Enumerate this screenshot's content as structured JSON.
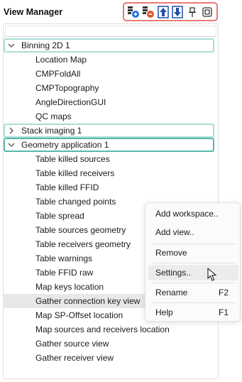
{
  "header": {
    "title": "View Manager"
  },
  "toolbar": {
    "buttons": [
      {
        "icon": "add-view-icon"
      },
      {
        "icon": "remove-view-icon"
      },
      {
        "icon": "move-up-icon"
      },
      {
        "icon": "move-down-icon"
      },
      {
        "icon": "pin-icon"
      },
      {
        "icon": "float-window-icon"
      }
    ],
    "accent": "#e87a7a"
  },
  "tree": {
    "groups": [
      {
        "label": "Binning 2D 1",
        "expanded": true,
        "children": [
          "Location Map",
          "CMPFoldAll",
          "CMPTopography",
          "AngleDirectionGUI",
          "QC maps"
        ]
      },
      {
        "label": "Stack imaging 1",
        "expanded": false,
        "children": []
      },
      {
        "label": "Geometry application 1",
        "expanded": true,
        "children": [
          "Table killed sources",
          "Table killed receivers",
          "Table killed FFID",
          "Table changed points",
          "Table spread",
          "Table sources geometry",
          "Table receivers geometry",
          "Table warnings",
          "Table FFID raw",
          "Map keys location",
          "Gather connection key view",
          "Map SP-Offset location",
          "Map sources and receivers location",
          "Gather source view",
          "Gather receiver view"
        ]
      }
    ],
    "group_border_color": "#a9ddd6",
    "active_group_border_color": "#57b8ab"
  },
  "context_menu": {
    "items": [
      {
        "label": "Add workspace..",
        "shortcut": ""
      },
      {
        "label": "Add view..",
        "shortcut": ""
      },
      {
        "label": "Remove",
        "shortcut": ""
      },
      {
        "label": "Settings..",
        "shortcut": ""
      },
      {
        "label": "Rename",
        "shortcut": "F2"
      },
      {
        "label": "Help",
        "shortcut": "F1"
      }
    ]
  }
}
